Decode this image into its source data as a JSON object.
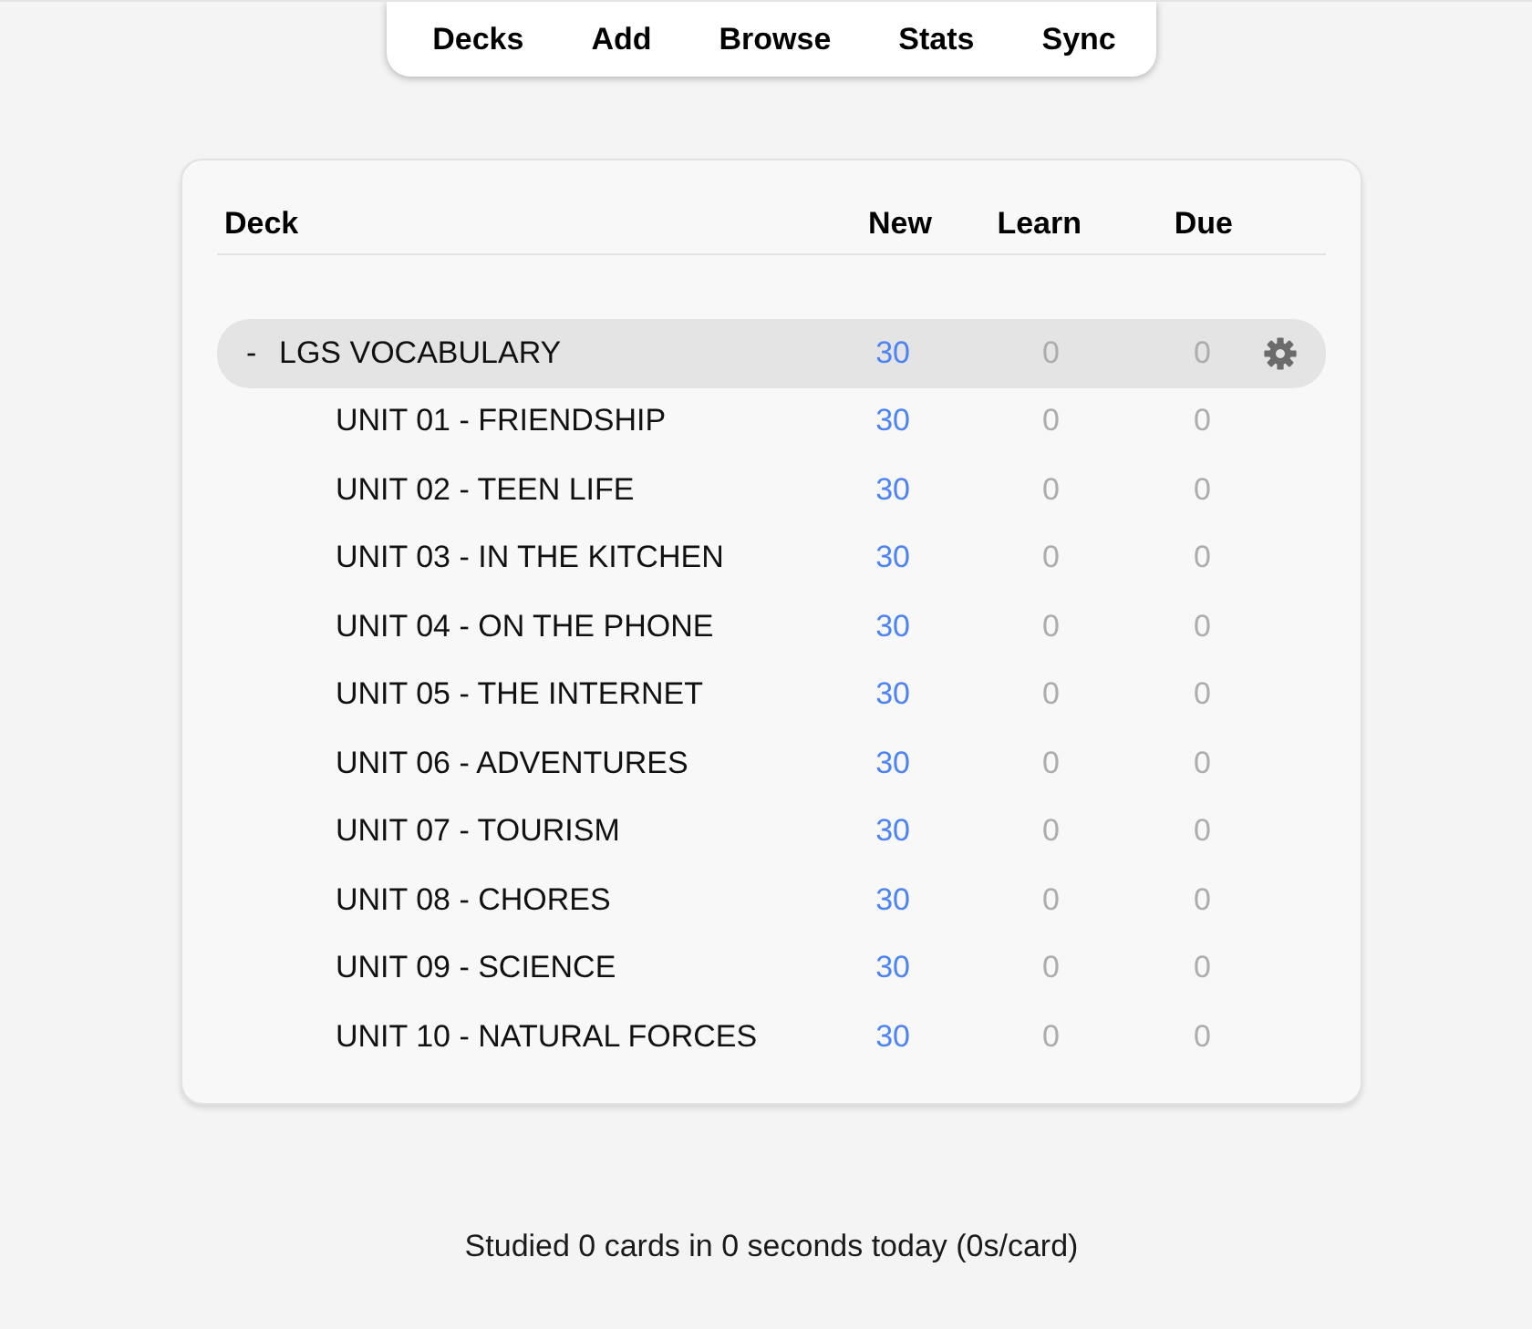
{
  "toolbar": {
    "items": [
      "Decks",
      "Add",
      "Browse",
      "Stats",
      "Sync"
    ]
  },
  "table": {
    "columns": [
      "Deck",
      "New",
      "Learn",
      "Due"
    ],
    "decks": [
      {
        "toggle": "-",
        "name": "LGS VOCABULARY",
        "new": "30",
        "learn": "0",
        "due": "0",
        "selected": true,
        "children": [
          {
            "name": "UNIT 01 - FRIENDSHIP",
            "new": "30",
            "learn": "0",
            "due": "0",
            "selected": false
          },
          {
            "name": "UNIT 02 - TEEN LIFE",
            "new": "30",
            "learn": "0",
            "due": "0",
            "selected": false
          },
          {
            "name": "UNIT 03 - IN THE KITCHEN",
            "new": "30",
            "learn": "0",
            "due": "0",
            "selected": false
          },
          {
            "name": "UNIT 04 - ON THE PHONE",
            "new": "30",
            "learn": "0",
            "due": "0",
            "selected": false
          },
          {
            "name": "UNIT 05 - THE INTERNET",
            "new": "30",
            "learn": "0",
            "due": "0",
            "selected": false
          },
          {
            "name": "UNIT 06 - ADVENTURES",
            "new": "30",
            "learn": "0",
            "due": "0",
            "selected": false
          },
          {
            "name": "UNIT 07 - TOURISM",
            "new": "30",
            "learn": "0",
            "due": "0",
            "selected": false
          },
          {
            "name": "UNIT 08 - CHORES",
            "new": "30",
            "learn": "0",
            "due": "0",
            "selected": false
          },
          {
            "name": "UNIT 09 - SCIENCE",
            "new": "30",
            "learn": "0",
            "due": "0",
            "selected": false
          },
          {
            "name": "UNIT 10 - NATURAL FORCES",
            "new": "30",
            "learn": "0",
            "due": "0",
            "selected": false
          }
        ]
      }
    ]
  },
  "footer": {
    "text": "Studied 0 cards in 0 seconds today (0s/card)"
  }
}
